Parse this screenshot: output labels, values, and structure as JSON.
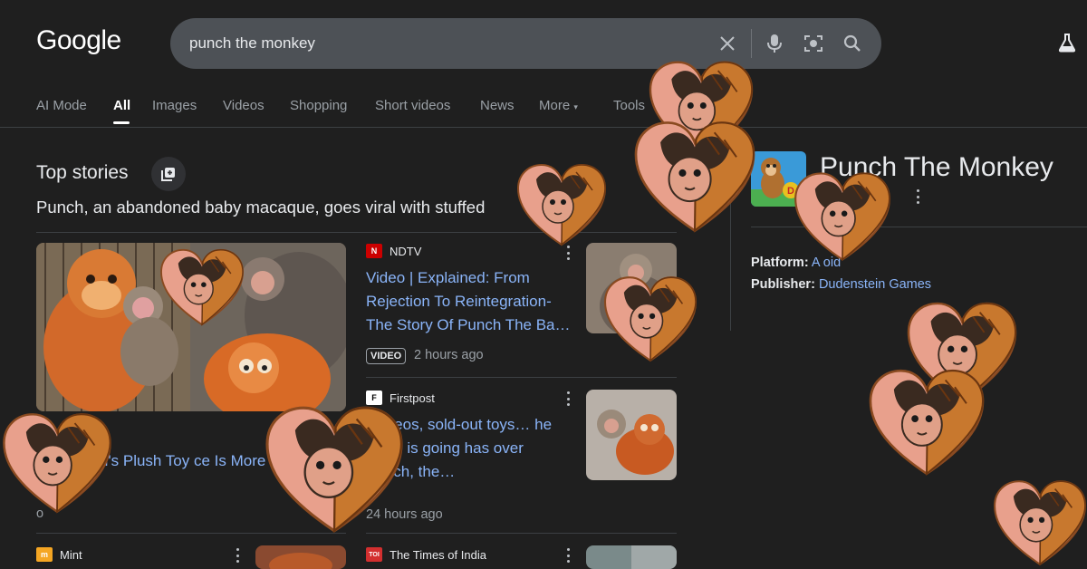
{
  "header": {
    "logo": "Google",
    "search_value": "punch the monkey"
  },
  "tabs": [
    {
      "label": "AI Mode"
    },
    {
      "label": "All"
    },
    {
      "label": "Images"
    },
    {
      "label": "Videos"
    },
    {
      "label": "Shopping"
    },
    {
      "label": "Short videos"
    },
    {
      "label": "News"
    },
    {
      "label": "More"
    },
    {
      "label": "Tools"
    }
  ],
  "top_stories": {
    "title": "Top stories",
    "subtitle": "Punch, an abandoned baby macaque, goes viral with stuffed",
    "featured": {
      "caption": "key Punch's Plush Toy ce Is More Than 30K",
      "time": "o"
    },
    "stories": [
      {
        "source": "NDTV",
        "source_logo": "N",
        "title": "Video | Explained: From Rejection To Reintegration- The Story Of Punch The Ba…",
        "badge": "VIDEO",
        "time": "2 hours ago"
      },
      {
        "source": "Firstpost",
        "source_logo": "F",
        "title": "/ videos, sold-out toys… he world is going has over Punch, the…",
        "time": "24 hours ago"
      },
      {
        "source": "Mint",
        "source_logo": "m"
      },
      {
        "source": "The Times of India",
        "source_logo": "TOI"
      }
    ]
  },
  "knowledge_panel": {
    "title": "Punch The Monkey",
    "subtitle": "me",
    "platform_label": "Platform:",
    "platform_value": "A    oid",
    "publisher_label": "Publisher:",
    "publisher_value": "Dudenstein Games"
  },
  "colors": {
    "background": "#1f1f1f",
    "link": "#8ab4f8",
    "searchbox": "#4d5156"
  }
}
